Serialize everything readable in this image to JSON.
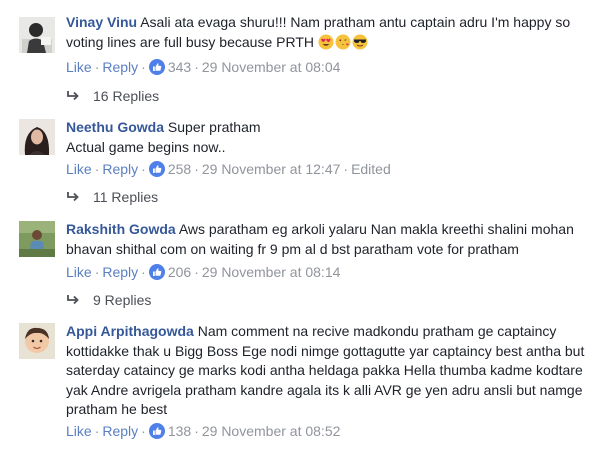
{
  "comments": [
    {
      "author": "Vinay Vinu",
      "text": "Asali ata evaga shuru!!! Nam pratham antu captain adru I'm happy so voting lines are full busy because PRTH",
      "emojis": [
        "heart-eyes-emoji",
        "kissing-heart-emoji",
        "sunglasses-emoji"
      ],
      "like_label": "Like",
      "reply_label": "Reply",
      "likes": "343",
      "date": "29 November at 08:04",
      "edited": "",
      "replies": "16 Replies"
    },
    {
      "author": "Neethu Gowda",
      "text": "Super pratham",
      "text2": "Actual game begins now..",
      "like_label": "Like",
      "reply_label": "Reply",
      "likes": "258",
      "date": "29 November at 12:47",
      "edited": "Edited",
      "replies": "11 Replies"
    },
    {
      "author": "Rakshith Gowda",
      "text": "Aws paratham eg arkoli yalaru Nan makla kreethi shalini mohan bhavan shithal com on waiting fr 9 pm al d bst paratham vote for pratham",
      "like_label": "Like",
      "reply_label": "Reply",
      "likes": "206",
      "date": "29 November at 08:14",
      "edited": "",
      "replies": "9 Replies"
    },
    {
      "author": "Appi Arpithagowda",
      "text": "Nam comment na recive madkondu pratham ge captaincy kottidakke thak u Bigg Boss Ege nodi nimge gottagutte yar captaincy best antha but saterday cataincy ge marks kodi antha heldaga pakka Hella thumba kadme kodtare yak Andre avrigela pratham kandre agala its k alli AVR ge yen adru ansli but namge pratham he best",
      "like_label": "Like",
      "reply_label": "Reply",
      "likes": "138",
      "date": "29 November at 08:52",
      "edited": ""
    }
  ],
  "colors": {
    "author": "#365899",
    "action_link": "#5a7fc1",
    "meta": "#90949c",
    "like_badge": "#4f7fe8",
    "text": "#1d2129"
  }
}
